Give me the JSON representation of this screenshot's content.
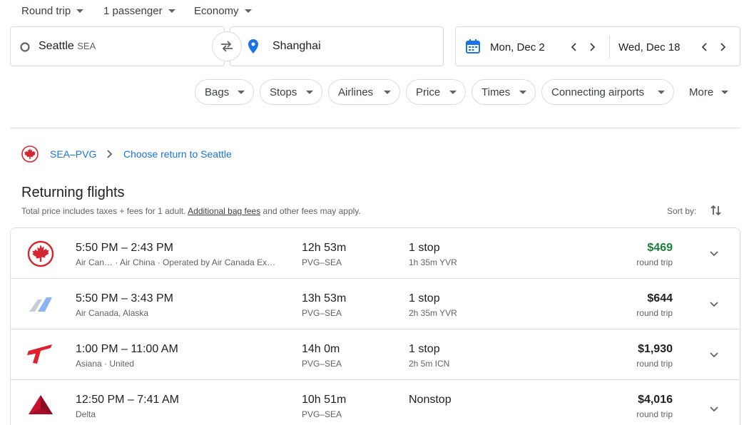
{
  "top_bar": {
    "trip_type": "Round trip",
    "passengers": "1 passenger",
    "cabin": "Economy"
  },
  "search": {
    "origin_city": "Seattle",
    "origin_code": "SEA",
    "destination": "Shanghai",
    "depart_date": "Mon, Dec 2",
    "return_date": "Wed, Dec 18"
  },
  "filters": [
    "Bags",
    "Stops",
    "Airlines",
    "Price",
    "Times",
    "Connecting airports"
  ],
  "filters_more": "More",
  "breadcrumb": {
    "outbound": "SEA–PVG",
    "current": "Choose return to Seattle"
  },
  "results": {
    "title": "Returning flights",
    "subtitle_pre": "Total price includes taxes + fees for 1 adult. ",
    "subtitle_link": "Additional bag fees",
    "subtitle_post": " and other fees may apply.",
    "sort_label": "Sort by:"
  },
  "flights": [
    {
      "times": "5:50 PM – 2:43 PM",
      "airline": "Air Can…  ·  Air China  ·  Operated by Air Canada Ex…",
      "duration": "12h 53m",
      "route": "PVG–SEA",
      "stops": "1 stop",
      "layover": "1h 35m YVR",
      "price": "$469",
      "price_type": "round trip",
      "logo": "air-canada-maple-icon"
    },
    {
      "times": "5:50 PM – 3:43 PM",
      "airline": "Air Canada, Alaska",
      "duration": "13h 53m",
      "route": "PVG–SEA",
      "stops": "1 stop",
      "layover": "2h 35m YVR",
      "price": "$644",
      "price_type": "round trip",
      "logo": "multi-airline-tail-icon"
    },
    {
      "times": "1:00 PM – 11:00 AM",
      "airline": "Asiana  ·  United",
      "duration": "14h 0m",
      "route": "PVG–SEA",
      "stops": "1 stop",
      "layover": "2h 5m ICN",
      "price": "$1,930",
      "price_type": "round trip",
      "logo": "asiana-wing-icon"
    },
    {
      "times": "12:50 PM – 7:41 AM",
      "airline": "Delta",
      "duration": "10h 51m",
      "route": "PVG–SEA",
      "stops": "Nonstop",
      "layover": "",
      "price": "$4,016",
      "price_type": "round trip",
      "logo": "delta-widget-icon"
    }
  ],
  "colors": {
    "accent_blue": "#1a73e8",
    "price_green": "#188038",
    "air_canada_red": "#d22630",
    "asiana_red": "#e0202e",
    "delta_red": "#c8102e"
  }
}
